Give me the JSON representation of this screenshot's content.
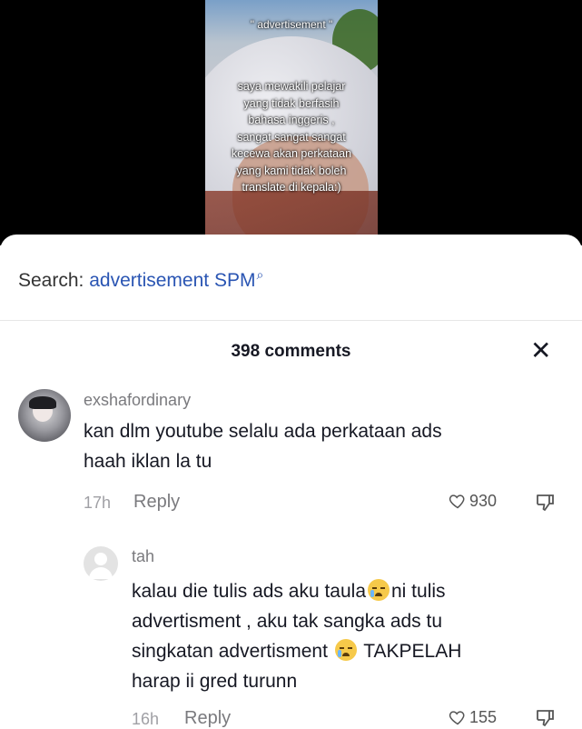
{
  "video": {
    "caption_title": "\" advertisement \"",
    "caption_lines": [
      "saya mewakili pelajar",
      "yang tidak berfasih",
      "bahasa inggeris ,",
      "sangat sangat sangat",
      "kecewa akan perkataan",
      "yang kami tidak boleh",
      "translate di kepala:)"
    ]
  },
  "search": {
    "prefix": "Search:",
    "term": "advertisement SPM"
  },
  "comments_header": {
    "count_label": "398 comments",
    "close_glyph": "✕"
  },
  "comments": [
    {
      "username": "exshafordinary",
      "text_lines": [
        "kan dlm youtube selalu ada perkataan ads",
        "haah iklan la tu"
      ],
      "time": "17h",
      "reply_label": "Reply",
      "likes": "930"
    },
    {
      "username": "tah",
      "text_line1_a": "kalau die tulis ads aku taula",
      "text_line1_b": "ni tulis",
      "text_line2": "advertisment , aku tak sangka ads tu",
      "text_line3_a": "singkatan advertisment",
      "text_line3_b": "TAKPELAH",
      "text_line4": "harap ii gred turunn",
      "emoji_name": "crying-face-emoji",
      "time": "16h",
      "reply_label": "Reply",
      "likes": "155"
    }
  ],
  "colors": {
    "accent": "#2a55b3",
    "text": "#161823",
    "muted": "#7a7a7e",
    "background": "#ffffff"
  }
}
